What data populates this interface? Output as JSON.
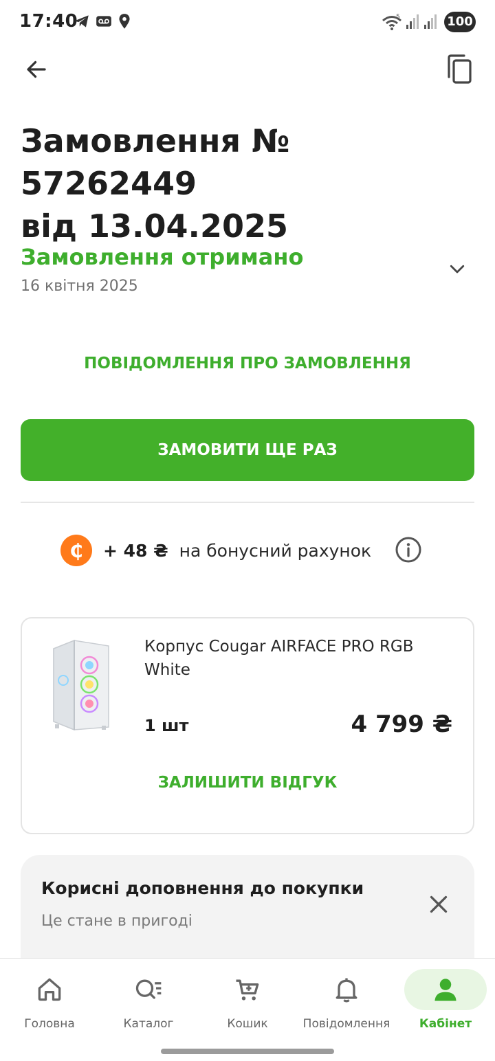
{
  "status_bar": {
    "time": "17:40",
    "battery": "100"
  },
  "header": {
    "title_line1": "Замовлення № 57262449",
    "title_line2": "від 13.04.2025"
  },
  "order_status": {
    "title": "Замовлення отримано",
    "date": "16 квітня 2025"
  },
  "actions": {
    "notifications_link": "ПОВІДОМЛЕННЯ ПРО ЗАМОВЛЕННЯ",
    "reorder_button": "ЗАМОВИТИ ЩЕ РАЗ"
  },
  "bonus": {
    "amount": "+ 48 ₴",
    "text": "на бонусний рахунок",
    "coin_symbol": "₵"
  },
  "product": {
    "name": "Корпус Cougar AIRFACE PRO RGB White",
    "quantity": "1 шт",
    "price": "4 799 ₴",
    "review_link": "ЗАЛИШИТИ ВІДГУК"
  },
  "addons": {
    "title": "Корисні доповнення до покупки",
    "subtitle": "Це стане в пригоді"
  },
  "bottom_nav": {
    "items": [
      {
        "label": "Головна",
        "icon": "home-icon"
      },
      {
        "label": "Каталог",
        "icon": "catalog-search-icon"
      },
      {
        "label": "Кошик",
        "icon": "cart-icon"
      },
      {
        "label": "Повідомлення",
        "icon": "bell-icon"
      },
      {
        "label": "Кабінет",
        "icon": "user-icon",
        "active": true
      }
    ]
  },
  "colors": {
    "brand_green": "#43b02a",
    "text_green": "#3eae2d",
    "coin_orange": "#ff7a1a"
  }
}
